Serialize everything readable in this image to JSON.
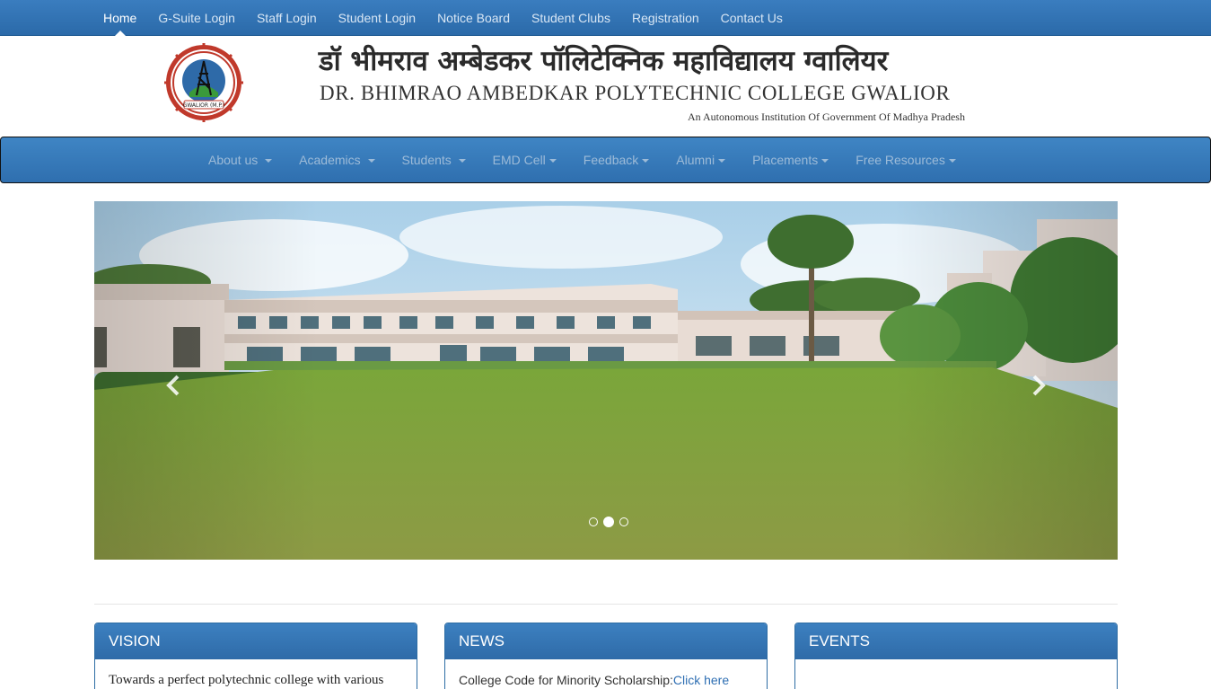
{
  "top_nav": {
    "items": [
      "Home",
      "G-Suite Login",
      "Staff Login",
      "Student Login",
      "Notice Board",
      "Student Clubs",
      "Registration",
      "Contact Us"
    ],
    "active": "Home"
  },
  "header": {
    "hindi_title": "डॉ भीमराव अम्बेडकर पॉलिटेक्निक महाविद्यालय ग्वालियर",
    "english_title": "DR. BHIMRAO AMBEDKAR POLYTECHNIC COLLEGE GWALIOR",
    "subtitle": "An Autonomous Institution Of Government Of Madhya Pradesh",
    "logo_text": "GWALIOR (M.P.)"
  },
  "main_nav": {
    "items": [
      "About us",
      "Academics",
      "Students",
      "EMD Cell",
      "Feedback",
      "Alumni",
      "Placements",
      "Free Resources"
    ]
  },
  "carousel": {
    "slide_count": 3,
    "active_index": 1,
    "prev_icon": "chevron-left-icon",
    "next_icon": "chevron-right-icon"
  },
  "panels": {
    "vision": {
      "title": "VISION",
      "text": "Towards a perfect polytechnic college with various"
    },
    "news": {
      "title": "NEWS",
      "text": "College Code for Minority Scholarship:",
      "link": "Click here"
    },
    "events": {
      "title": "EVENTS"
    }
  },
  "colors": {
    "nav_blue": "#2f6fb3",
    "panel_blue": "#337ab7",
    "link_blue": "#2f6fb3"
  }
}
